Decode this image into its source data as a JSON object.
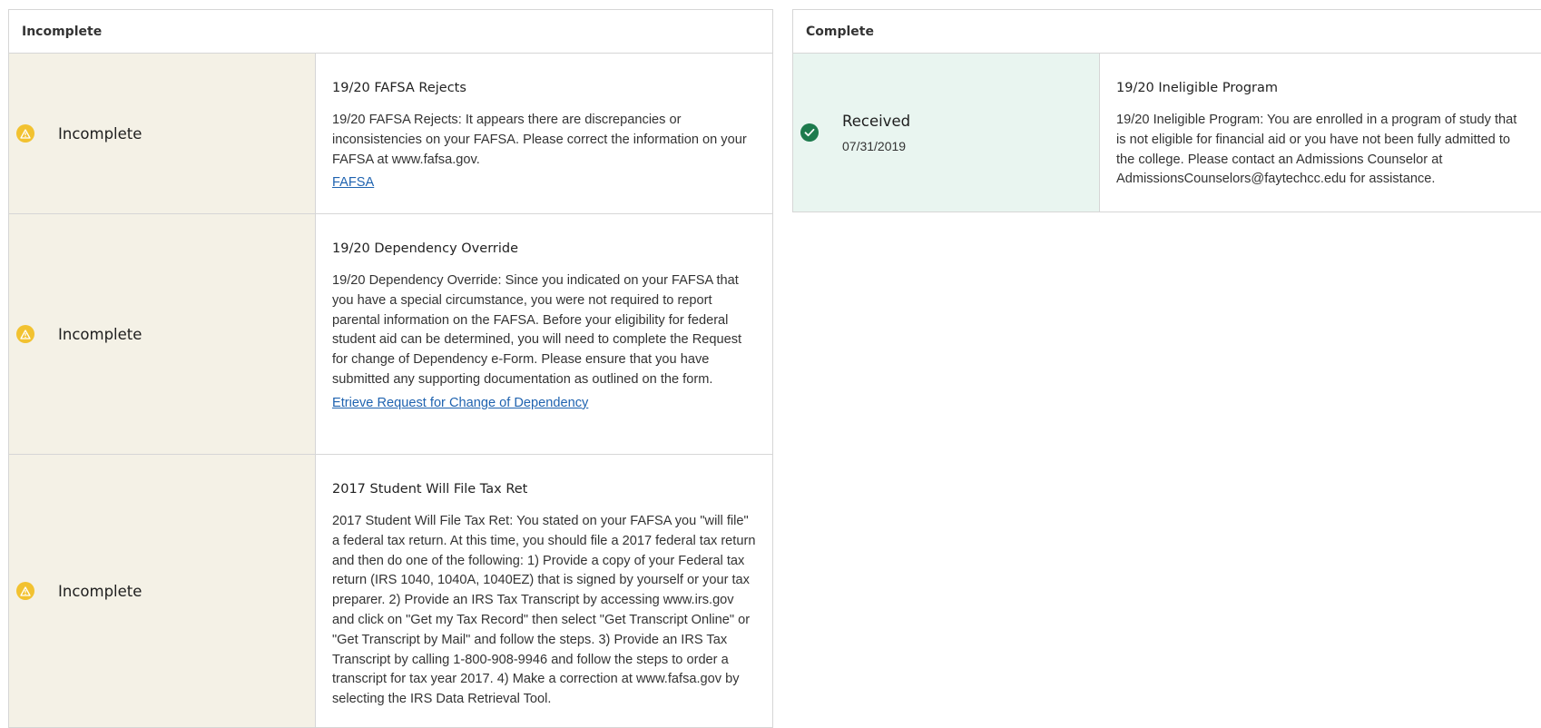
{
  "incomplete_panel": {
    "header": "Incomplete",
    "items": [
      {
        "status": "Incomplete",
        "title": "19/20 FAFSA Rejects",
        "body": "19/20 FAFSA Rejects: It appears there are discrepancies or inconsistencies on your FAFSA. Please correct the information on your FAFSA at www.fafsa.gov.",
        "link": "FAFSA"
      },
      {
        "status": "Incomplete",
        "title": "19/20 Dependency Override",
        "body": "19/20 Dependency Override: Since you indicated on your FAFSA that you have a special circumstance, you were not required to report parental information on the FAFSA. Before your eligibility for federal student aid can be determined, you will need to complete the Request for change of Dependency e-Form. Please ensure that you have submitted any supporting documentation as outlined on the form.",
        "link": "Etrieve Request for Change of Dependency"
      },
      {
        "status": "Incomplete",
        "title": "2017 Student Will File Tax Ret",
        "body": "2017 Student Will File Tax Ret: You stated on your FAFSA you \"will file\" a federal tax return. At this time, you should file a 2017 federal tax return and then do one of the following: 1) Provide a copy of your Federal tax return (IRS 1040, 1040A, 1040EZ) that is signed by yourself or your tax preparer. 2) Provide an IRS Tax Transcript by accessing www.irs.gov and click on \"Get my Tax Record\" then select \"Get Transcript Online\" or \"Get Transcript by Mail\" and follow the steps. 3) Provide an IRS Tax Transcript by calling 1-800-908-9946 and follow the steps to order a transcript for tax year 2017. 4) Make a correction at www.fafsa.gov by selecting the IRS Data Retrieval Tool."
      }
    ]
  },
  "complete_panel": {
    "header": "Complete",
    "items": [
      {
        "status": "Received",
        "date": "07/31/2019",
        "title": "19/20 Ineligible Program",
        "body": "19/20 Ineligible Program: You are enrolled in a program of study that is not eligible for financial aid or you have not been fully admitted to the college. Please contact an Admissions Counselor at AdmissionsCounselors@faytechcc.edu for assistance."
      }
    ]
  },
  "icons": {
    "incomplete": "warning-icon",
    "complete": "check-circle-icon"
  },
  "colors": {
    "incomplete_bg": "#f4f1e6",
    "complete_bg": "#e9f5f0",
    "warning": "#f2c230",
    "success": "#1d7a4d",
    "link": "#1f63b0"
  }
}
